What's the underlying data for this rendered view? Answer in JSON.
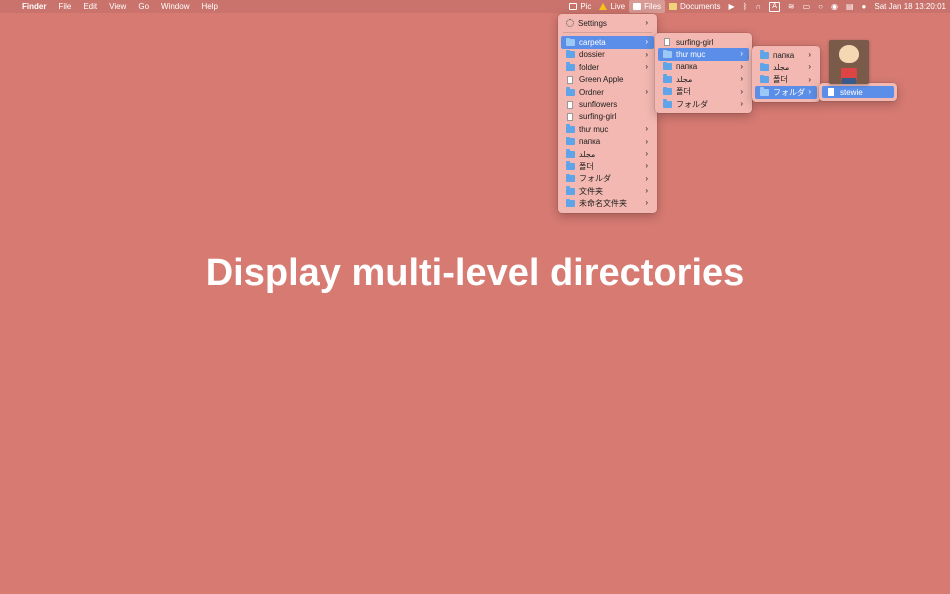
{
  "menubar": {
    "apple": "",
    "app_name": "Finder",
    "menus": [
      "File",
      "Edit",
      "View",
      "Go",
      "Window",
      "Help"
    ],
    "extras": {
      "pic": "Pic",
      "live": "Live",
      "files": "Files",
      "documents": "Documents",
      "input_indicator": "A",
      "clock": "Sat Jan 18  13:20:01"
    }
  },
  "menu1": {
    "settings": "Settings",
    "items": [
      {
        "label": "carpeta",
        "type": "folder",
        "submenu": true
      },
      {
        "label": "dossier",
        "type": "folder",
        "submenu": true
      },
      {
        "label": "folder",
        "type": "folder",
        "submenu": true
      },
      {
        "label": "Green Apple",
        "type": "file",
        "submenu": false
      },
      {
        "label": "Ordner",
        "type": "folder",
        "submenu": true
      },
      {
        "label": "sunflowers",
        "type": "file",
        "submenu": false
      },
      {
        "label": "surfing-girl",
        "type": "file",
        "submenu": false
      },
      {
        "label": "thư mục",
        "type": "folder",
        "submenu": true
      },
      {
        "label": "папка",
        "type": "folder",
        "submenu": true
      },
      {
        "label": "مجلد",
        "type": "folder",
        "submenu": true
      },
      {
        "label": "폴더",
        "type": "folder",
        "submenu": true
      },
      {
        "label": "フォルダ",
        "type": "folder",
        "submenu": true
      },
      {
        "label": "文件夹",
        "type": "folder",
        "submenu": true
      },
      {
        "label": "未命名文件夹",
        "type": "folder",
        "submenu": true
      }
    ]
  },
  "menu2": {
    "items": [
      {
        "label": "surfing-girl",
        "type": "file",
        "submenu": false
      },
      {
        "label": "thư mục",
        "type": "folder",
        "submenu": true
      },
      {
        "label": "папка",
        "type": "folder",
        "submenu": true
      },
      {
        "label": "مجلد",
        "type": "folder",
        "submenu": true
      },
      {
        "label": "폴더",
        "type": "folder",
        "submenu": true
      },
      {
        "label": "フォルダ",
        "type": "folder",
        "submenu": true
      }
    ]
  },
  "menu3": {
    "items": [
      {
        "label": "папка",
        "type": "folder",
        "submenu": true
      },
      {
        "label": "مجلد",
        "type": "folder",
        "submenu": true
      },
      {
        "label": "폴더",
        "type": "folder",
        "submenu": true
      },
      {
        "label": "フォルダ",
        "type": "folder",
        "submenu": true
      }
    ]
  },
  "menu4": {
    "items": [
      {
        "label": "stewie",
        "type": "file",
        "submenu": false
      }
    ]
  },
  "headline": "Display multi-level directories",
  "colors": {
    "desktop": "#d67a72",
    "menu_bg": "#f2b8b1",
    "selection": "#5b8ee8",
    "folder_icon": "#5fa4e8"
  }
}
